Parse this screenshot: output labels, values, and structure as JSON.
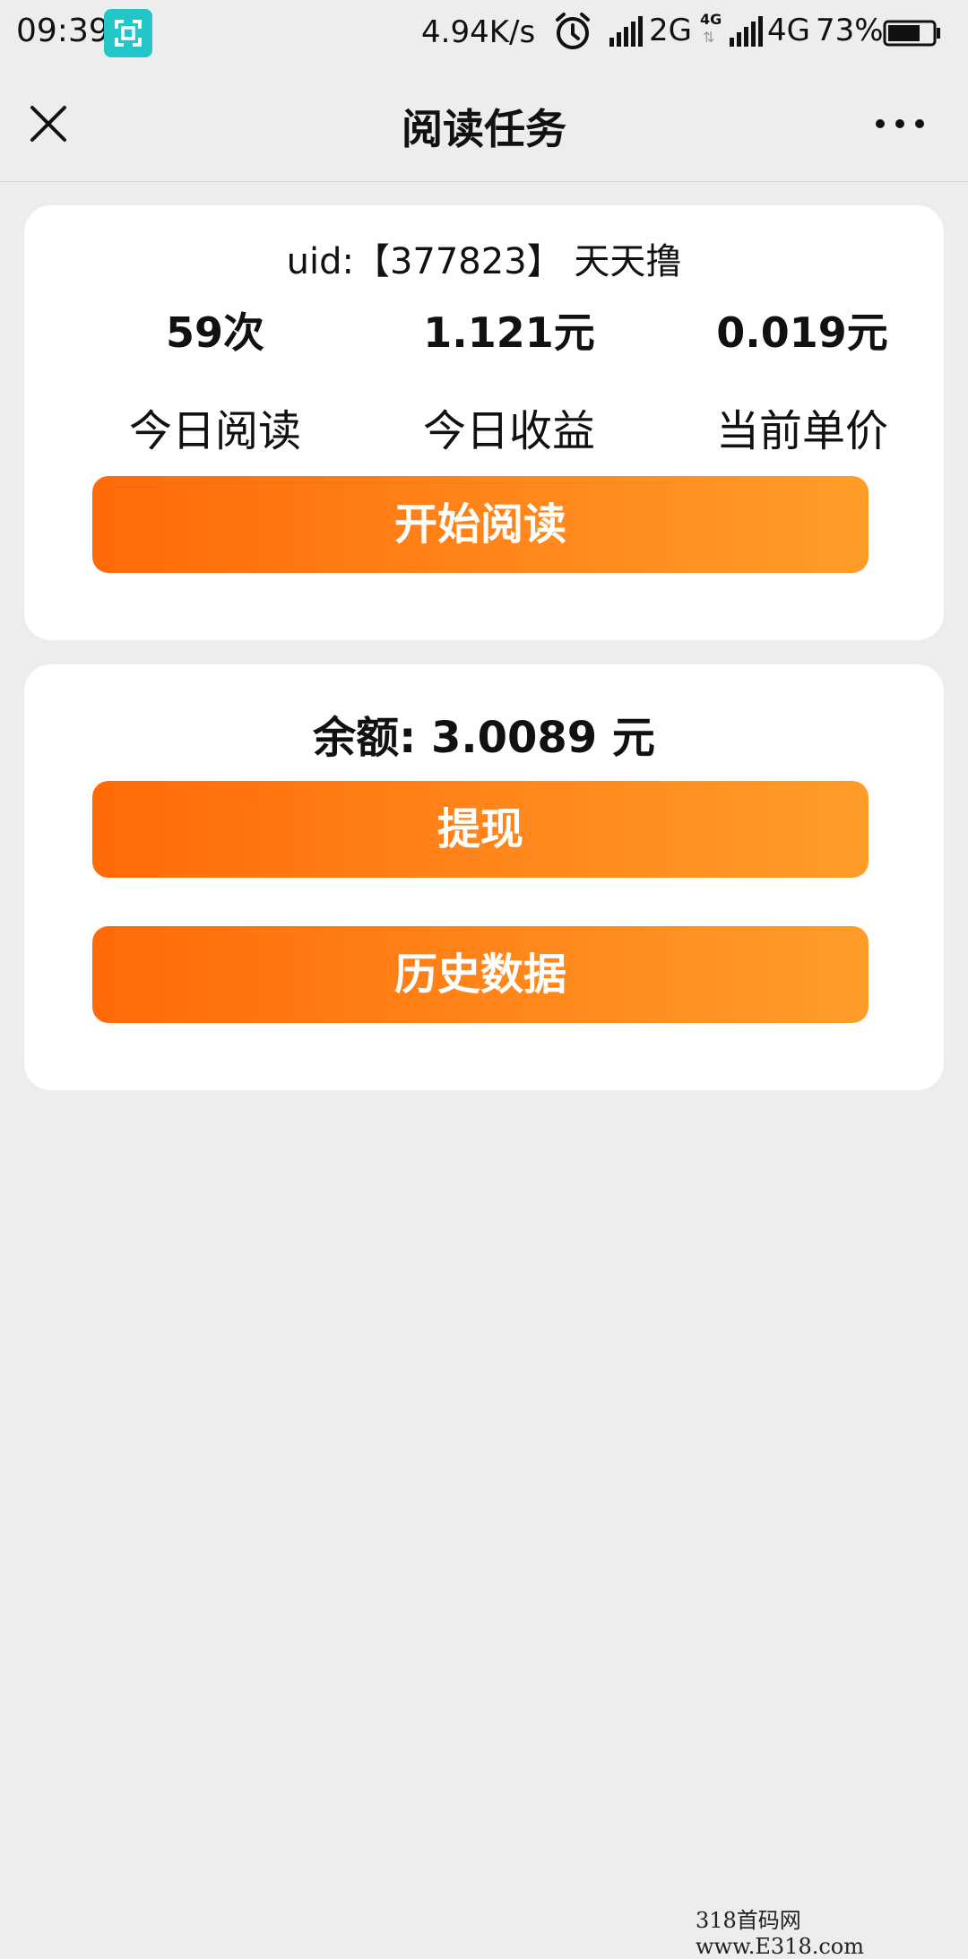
{
  "status_bar": {
    "time": "09:39",
    "speed": "4.94K/s",
    "net1": "2G",
    "net2_small": "4G",
    "net2": "4G",
    "battery_pct": "73%",
    "battery_level": 0.73
  },
  "nav": {
    "title": "阅读任务"
  },
  "account": {
    "uid_line": "uid:【377823】 天天撸"
  },
  "stats": [
    {
      "value": "59次",
      "label": "今日阅读"
    },
    {
      "value": "1.121元",
      "label": "今日收益"
    },
    {
      "value": "0.019元",
      "label": "当前单价"
    }
  ],
  "buttons": {
    "start_reading": "开始阅读",
    "withdraw": "提现",
    "history": "历史数据"
  },
  "balance": {
    "text": "余额: 3.0089 元"
  },
  "watermark": "318首码网  www.E318.com"
}
